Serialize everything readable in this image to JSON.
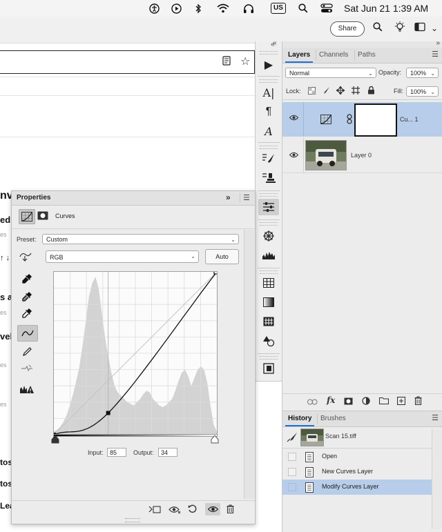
{
  "menubar": {
    "icons": [
      "accessibility-icon",
      "play-circle-icon",
      "bluetooth-icon",
      "wifi-icon",
      "headphones-icon",
      "keyboard-input-icon",
      "search-icon",
      "control-center-icon"
    ],
    "input_source": "US",
    "clock": "Sat Jun 21  1:39 AM"
  },
  "browser": {
    "share_label": "Share"
  },
  "webpage": {
    "fragments": [
      "nv",
      "ed",
      "es",
      "↑ ↓",
      "s ad",
      "es",
      "vels",
      "es",
      "es",
      "tos",
      "tos",
      "Lea"
    ]
  },
  "layers_panel": {
    "tabs": [
      "Layers",
      "Channels",
      "Paths"
    ],
    "active_tab": "Layers",
    "blend_mode": "Normal",
    "opacity_label": "Opacity:",
    "opacity_value": "100%",
    "lock_label": "Lock:",
    "fill_label": "Fill:",
    "fill_value": "100%",
    "layers": [
      {
        "name": "Cu... 1",
        "selected": true
      },
      {
        "name": "Layer 0",
        "selected": false
      }
    ]
  },
  "properties_panel": {
    "title": "Properties",
    "adjustment_name": "Curves",
    "preset_label": "Preset:",
    "preset_value": "Custom",
    "channel_value": "RGB",
    "auto_label": "Auto",
    "input_label": "Input:",
    "input_value": "85",
    "output_label": "Output:",
    "output_value": "34"
  },
  "history_panel": {
    "tabs": [
      "History",
      "Brushes"
    ],
    "active_tab": "History",
    "snapshot_name": "Scan 15.tiff",
    "states": [
      {
        "label": "Open",
        "selected": false
      },
      {
        "label": "New Curves Layer",
        "selected": false
      },
      {
        "label": "Modify Curves Layer",
        "selected": true
      }
    ]
  },
  "colors": {
    "selection": "#b7cde9",
    "accent": "#1f6fd8",
    "panel": "#ececec"
  }
}
